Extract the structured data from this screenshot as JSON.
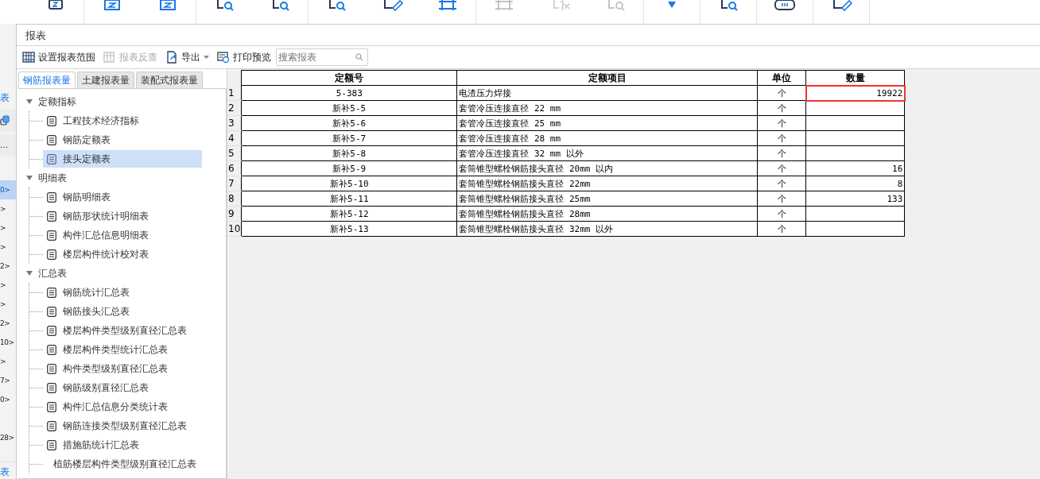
{
  "ribbon": {
    "groups": [
      {
        "buttons": [
          {
            "kind": "calc",
            "disabled": false
          }
        ]
      },
      {
        "buttons": [
          {
            "kind": "sum",
            "disabled": false
          },
          {
            "kind": "pick",
            "disabled": false
          }
        ]
      },
      {
        "buttons": [
          {
            "kind": "view",
            "disabled": false
          },
          {
            "kind": "view",
            "disabled": false
          }
        ]
      },
      {
        "buttons": [
          {
            "kind": "view",
            "disabled": false
          },
          {
            "kind": "edit",
            "disabled": false
          },
          {
            "kind": "rebar",
            "disabled": false
          }
        ]
      },
      {
        "buttons": [
          {
            "kind": "rebar",
            "disabled": true
          },
          {
            "kind": "formula",
            "disabled": true
          },
          {
            "kind": "view",
            "disabled": true
          }
        ]
      },
      {
        "buttons": [
          {
            "kind": "check",
            "disabled": false
          }
        ]
      },
      {
        "buttons": [
          {
            "kind": "view",
            "disabled": false
          }
        ]
      },
      {
        "buttons": [
          {
            "kind": "index",
            "disabled": false
          }
        ]
      },
      {
        "buttons": [
          {
            "kind": "edit",
            "disabled": false
          }
        ]
      }
    ]
  },
  "side_strip": {
    "top": [
      {
        "kind": "link",
        "text": "表"
      },
      {
        "kind": "icon"
      },
      {
        "kind": "more",
        "text": "..."
      }
    ],
    "rows": [
      {
        "text": "0>",
        "selected": true
      },
      {
        "text": ">",
        "selected": false
      },
      {
        "text": ">",
        "selected": false
      },
      {
        "text": ">",
        "selected": false
      },
      {
        "text": "2>",
        "selected": false
      },
      {
        "text": ">",
        "selected": false
      },
      {
        "text": ">",
        "selected": false
      },
      {
        "text": "2>",
        "selected": false
      },
      {
        "text": "10>",
        "selected": false
      },
      {
        "text": ">",
        "selected": false
      },
      {
        "text": "7>",
        "selected": false
      },
      {
        "text": "0>",
        "selected": false
      },
      {
        "selected": false
      },
      {
        "text": "28>",
        "selected": false
      }
    ],
    "bottom": {
      "text": "表"
    }
  },
  "window": {
    "title": "报表"
  },
  "toolbar": [
    {
      "kind": "range",
      "label": "设置报表范围",
      "disabled": false
    },
    {
      "kind": "reverse",
      "label": "报表反查",
      "disabled": true
    },
    {
      "kind": "export",
      "label": "导出",
      "disabled": false,
      "dropdown": true
    },
    {
      "kind": "print",
      "label": "打印预览",
      "disabled": false
    }
  ],
  "search": {
    "placeholder": "搜索报表"
  },
  "tabs": [
    {
      "label": "钢筋报表量",
      "selected": true
    },
    {
      "label": "土建报表量",
      "selected": false
    },
    {
      "label": "装配式报表量",
      "selected": false
    }
  ],
  "tree": [
    {
      "label": "定额指标",
      "expanded": true,
      "children": [
        {
          "label": "工程技术经济指标",
          "selected": false
        },
        {
          "label": "钢筋定额表",
          "selected": false
        },
        {
          "label": "接头定额表",
          "selected": true
        }
      ]
    },
    {
      "label": "明细表",
      "expanded": true,
      "children": [
        {
          "label": "钢筋明细表",
          "selected": false
        },
        {
          "label": "钢筋形状统计明细表",
          "selected": false
        },
        {
          "label": "构件汇总信息明细表",
          "selected": false
        },
        {
          "label": "楼层构件统计校对表",
          "selected": false
        }
      ]
    },
    {
      "label": "汇总表",
      "expanded": true,
      "children": [
        {
          "label": "钢筋统计汇总表",
          "selected": false
        },
        {
          "label": "钢筋接头汇总表",
          "selected": false
        },
        {
          "label": "楼层构件类型级别直径汇总表",
          "selected": false
        },
        {
          "label": "楼层构件类型统计汇总表",
          "selected": false
        },
        {
          "label": "构件类型级别直径汇总表",
          "selected": false
        },
        {
          "label": "钢筋级别直径汇总表",
          "selected": false
        },
        {
          "label": "构件汇总信息分类统计表",
          "selected": false
        },
        {
          "label": "钢筋连接类型级别直径汇总表",
          "selected": false
        },
        {
          "label": "措施筋统计汇总表",
          "selected": false
        },
        {
          "label": "植筋楼层构件类型级别直径汇总表",
          "selected": false
        }
      ]
    }
  ],
  "table": {
    "columns": [
      "定额号",
      "定额项目",
      "单位",
      "数量"
    ],
    "rows": [
      {
        "number": "1",
        "code": "5-383",
        "item": "电渣压力焊接",
        "unit": "个",
        "quantity": "19922",
        "highlighted": true
      },
      {
        "number": "2",
        "code": "新补5-5",
        "item": "套管冷压连接直径 22 mm",
        "unit": "个",
        "highlighted": false
      },
      {
        "number": "3",
        "code": "新补5-6",
        "item": "套管冷压连接直径 25 mm",
        "unit": "个",
        "highlighted": false
      },
      {
        "number": "4",
        "code": "新补5-7",
        "item": "套管冷压连接直径 28 mm",
        "unit": "个",
        "highlighted": false
      },
      {
        "number": "5",
        "code": "新补5-8",
        "item": "套管冷压连接直径 32 mm 以外",
        "unit": "个",
        "highlighted": false
      },
      {
        "number": "6",
        "code": "新补5-9",
        "item": "套筒锥型螺栓钢筋接头直径 20mm 以内",
        "unit": "个",
        "quantity": "16",
        "highlighted": false
      },
      {
        "number": "7",
        "code": "新补5-10",
        "item": "套筒锥型螺栓钢筋接头直径 22mm",
        "unit": "个",
        "quantity": "8",
        "highlighted": false
      },
      {
        "number": "8",
        "code": "新补5-11",
        "item": "套筒锥型螺栓钢筋接头直径 25mm",
        "unit": "个",
        "quantity": "133",
        "highlighted": false
      },
      {
        "number": "9",
        "code": "新补5-12",
        "item": "套筒锥型螺栓钢筋接头直径 28mm",
        "unit": "个",
        "highlighted": false
      },
      {
        "number": "10",
        "code": "新补5-13",
        "item": "套筒锥型螺栓钢筋接头直径 32mm 以外",
        "unit": "个",
        "highlighted": false
      }
    ]
  }
}
